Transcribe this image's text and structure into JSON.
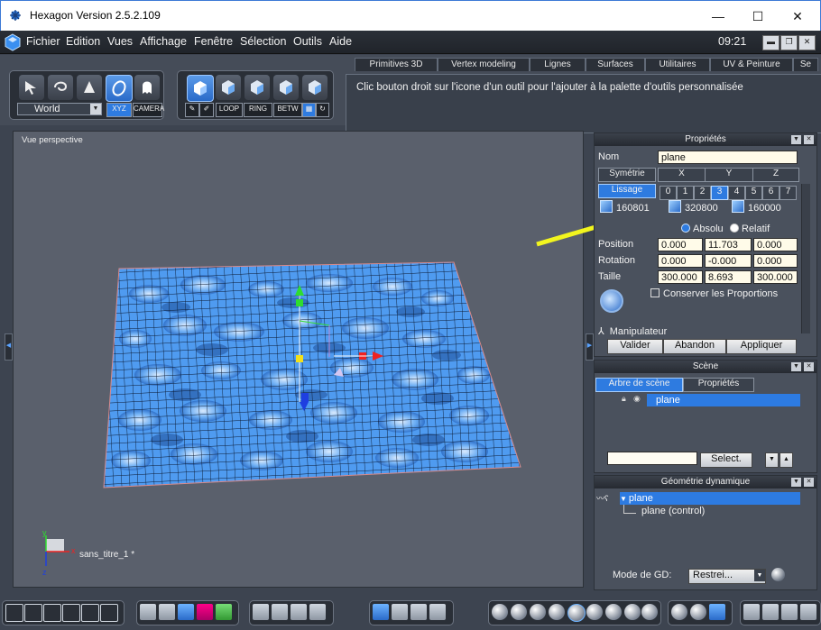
{
  "window": {
    "title": "Hexagon Version 2.5.2.109",
    "minimize": "—",
    "maximize": "☐",
    "close": "✕"
  },
  "menu": {
    "items": [
      "Fichier",
      "Edition",
      "Vues",
      "Affichage",
      "Fenêtre",
      "Sélection",
      "Outils",
      "Aide"
    ],
    "clock": "09:21"
  },
  "toolbar": {
    "coord_system": "World",
    "xyz": "XYZ",
    "camera": "CAMERA",
    "loop": "LOOP",
    "ring": "RING",
    "betw": "BETW",
    "tabs": [
      "Primitives 3D",
      "Vertex modeling",
      "Lignes",
      "Surfaces",
      "Utilitaires",
      "UV & Peinture",
      "Se"
    ],
    "hint": "Clic bouton droit sur l'icone d'un outil pour l'ajouter à la palette d'outils personnalisée"
  },
  "viewport": {
    "label": "Vue perspective",
    "filename": "sans_titre_1 *",
    "axes": {
      "x": "x",
      "y": "y",
      "z": "z"
    }
  },
  "properties": {
    "title": "Propriétés",
    "name_label": "Nom",
    "name_value": "plane",
    "symmetry_button": "Symétrie",
    "axes": [
      "X",
      "Y",
      "Z"
    ],
    "smoothing_button": "Lissage",
    "smoothing_levels": [
      "0",
      "1",
      "2",
      "3",
      "4",
      "5",
      "6",
      "7"
    ],
    "stats": [
      "160801",
      "320800",
      "160000"
    ],
    "mode_absolute": "Absolu",
    "mode_relative": "Relatif",
    "position_label": "Position",
    "position": [
      "0.000",
      "11.703",
      "0.000"
    ],
    "rotation_label": "Rotation",
    "rotation": [
      "0.000",
      "-0.000",
      "0.000"
    ],
    "size_label": "Taille",
    "size": [
      "300.000",
      "8.693",
      "300.000"
    ],
    "keep_proportions": "Conserver les Proportions",
    "manipulator": "Manipulateur",
    "validate": "Valider",
    "cancel": "Abandon",
    "apply": "Appliquer"
  },
  "scene": {
    "title": "Scène",
    "tab_tree": "Arbre de scène",
    "tab_props": "Propriétés",
    "item": "plane",
    "select_button": "Select."
  },
  "dyngeo": {
    "title": "Géométrie dynamique",
    "item": "plane",
    "child": "plane (control)",
    "mode_label": "Mode de GD:",
    "mode_value": "Restrei..."
  },
  "colors": {
    "accent": "#2e7be0",
    "arrow": "#f2f51e",
    "mesh": "#4f9bf0"
  }
}
